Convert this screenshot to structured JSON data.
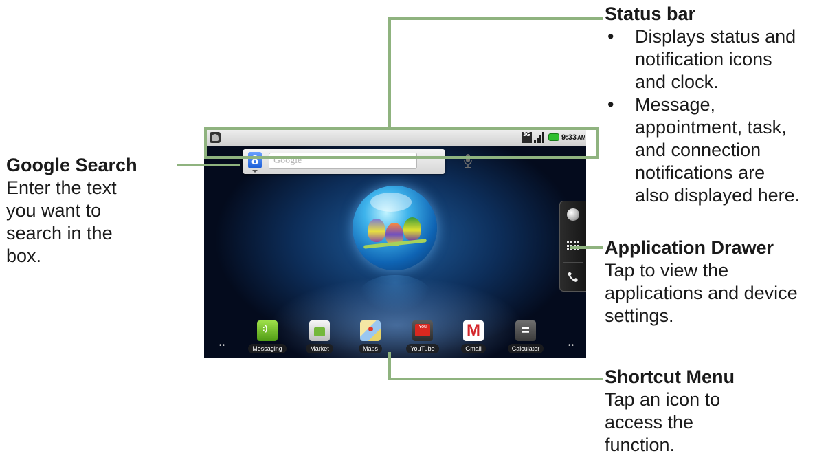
{
  "annotations": {
    "status_bar": {
      "title": "Status bar",
      "bullets": [
        [
          "Displays status and",
          "notification icons",
          "and clock."
        ],
        [
          "Message,",
          "appointment, task,",
          "and connection",
          "notifications are",
          "also displayed here."
        ]
      ]
    },
    "google_search": {
      "title": "Google Search",
      "lines": [
        "Enter the text",
        "you want to",
        "search in the",
        "box."
      ]
    },
    "app_drawer": {
      "title": "Application Drawer",
      "lines": [
        "Tap to view the",
        "applications and device",
        "settings."
      ]
    },
    "shortcut_menu": {
      "title": "Shortcut Menu",
      "lines": [
        "Tap an icon to",
        "access the",
        "function."
      ]
    }
  },
  "screen": {
    "status_bar": {
      "network": "3G",
      "time": "9:33",
      "ampm": "AM"
    },
    "search": {
      "logo": "8",
      "placeholder": "Google"
    },
    "dock": [
      {
        "label": "Messaging",
        "icon": "messaging-icon"
      },
      {
        "label": "Market",
        "icon": "market-icon"
      },
      {
        "label": "Maps",
        "icon": "maps-icon"
      },
      {
        "label": "YouTube",
        "icon": "youtube-icon"
      },
      {
        "label": "Gmail",
        "icon": "gmail-icon"
      },
      {
        "label": "Calculator",
        "icon": "calculator-icon"
      }
    ],
    "page_dots": "••"
  },
  "colors": {
    "callout_line": "#8fb37f",
    "text": "#1a1a1a"
  }
}
